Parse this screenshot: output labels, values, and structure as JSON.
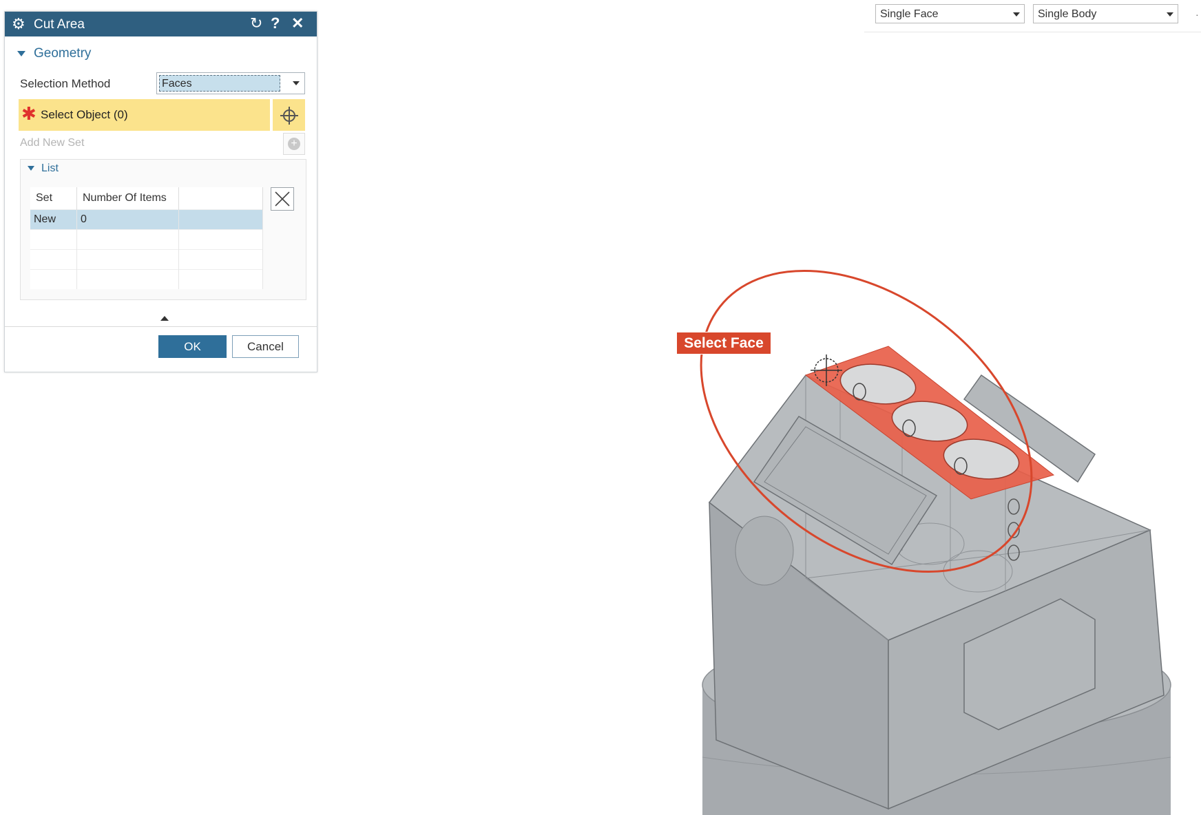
{
  "toolbar": {
    "face_filter": "Single Face",
    "body_filter": "Single Body"
  },
  "dialog": {
    "title": "Cut Area",
    "section_title": "Geometry",
    "selection_method_label": "Selection Method",
    "selection_method_value": "Faces",
    "select_object_label": "Select Object (0)",
    "add_new_set_label": "Add New Set",
    "list_title": "List",
    "table": {
      "headers": [
        "Set",
        "Number Of Items"
      ],
      "rows": [
        [
          "New",
          "0"
        ]
      ]
    },
    "ok_label": "OK",
    "cancel_label": "Cancel"
  },
  "viewport": {
    "tooltip": "Select Face",
    "highlight_color": "#e8604a",
    "annotation_color": "#d8472c",
    "model_color": "#a9adb1"
  },
  "icons": [
    "gear-icon",
    "reset-icon",
    "help-icon",
    "close-icon",
    "crosshair-icon",
    "add-icon",
    "clear-list-icon",
    "cursor-icon"
  ]
}
